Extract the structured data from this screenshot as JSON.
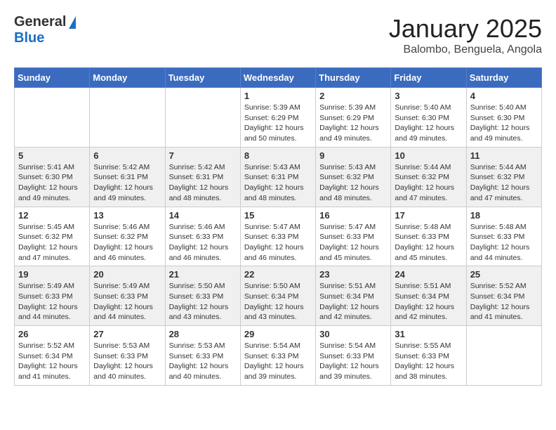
{
  "header": {
    "logo_general": "General",
    "logo_blue": "Blue",
    "month_title": "January 2025",
    "subtitle": "Balombo, Benguela, Angola"
  },
  "days_of_week": [
    "Sunday",
    "Monday",
    "Tuesday",
    "Wednesday",
    "Thursday",
    "Friday",
    "Saturday"
  ],
  "weeks": [
    [
      {
        "day": "",
        "info": ""
      },
      {
        "day": "",
        "info": ""
      },
      {
        "day": "",
        "info": ""
      },
      {
        "day": "1",
        "info": "Sunrise: 5:39 AM\nSunset: 6:29 PM\nDaylight: 12 hours\nand 50 minutes."
      },
      {
        "day": "2",
        "info": "Sunrise: 5:39 AM\nSunset: 6:29 PM\nDaylight: 12 hours\nand 49 minutes."
      },
      {
        "day": "3",
        "info": "Sunrise: 5:40 AM\nSunset: 6:30 PM\nDaylight: 12 hours\nand 49 minutes."
      },
      {
        "day": "4",
        "info": "Sunrise: 5:40 AM\nSunset: 6:30 PM\nDaylight: 12 hours\nand 49 minutes."
      }
    ],
    [
      {
        "day": "5",
        "info": "Sunrise: 5:41 AM\nSunset: 6:30 PM\nDaylight: 12 hours\nand 49 minutes."
      },
      {
        "day": "6",
        "info": "Sunrise: 5:42 AM\nSunset: 6:31 PM\nDaylight: 12 hours\nand 49 minutes."
      },
      {
        "day": "7",
        "info": "Sunrise: 5:42 AM\nSunset: 6:31 PM\nDaylight: 12 hours\nand 48 minutes."
      },
      {
        "day": "8",
        "info": "Sunrise: 5:43 AM\nSunset: 6:31 PM\nDaylight: 12 hours\nand 48 minutes."
      },
      {
        "day": "9",
        "info": "Sunrise: 5:43 AM\nSunset: 6:32 PM\nDaylight: 12 hours\nand 48 minutes."
      },
      {
        "day": "10",
        "info": "Sunrise: 5:44 AM\nSunset: 6:32 PM\nDaylight: 12 hours\nand 47 minutes."
      },
      {
        "day": "11",
        "info": "Sunrise: 5:44 AM\nSunset: 6:32 PM\nDaylight: 12 hours\nand 47 minutes."
      }
    ],
    [
      {
        "day": "12",
        "info": "Sunrise: 5:45 AM\nSunset: 6:32 PM\nDaylight: 12 hours\nand 47 minutes."
      },
      {
        "day": "13",
        "info": "Sunrise: 5:46 AM\nSunset: 6:32 PM\nDaylight: 12 hours\nand 46 minutes."
      },
      {
        "day": "14",
        "info": "Sunrise: 5:46 AM\nSunset: 6:33 PM\nDaylight: 12 hours\nand 46 minutes."
      },
      {
        "day": "15",
        "info": "Sunrise: 5:47 AM\nSunset: 6:33 PM\nDaylight: 12 hours\nand 46 minutes."
      },
      {
        "day": "16",
        "info": "Sunrise: 5:47 AM\nSunset: 6:33 PM\nDaylight: 12 hours\nand 45 minutes."
      },
      {
        "day": "17",
        "info": "Sunrise: 5:48 AM\nSunset: 6:33 PM\nDaylight: 12 hours\nand 45 minutes."
      },
      {
        "day": "18",
        "info": "Sunrise: 5:48 AM\nSunset: 6:33 PM\nDaylight: 12 hours\nand 44 minutes."
      }
    ],
    [
      {
        "day": "19",
        "info": "Sunrise: 5:49 AM\nSunset: 6:33 PM\nDaylight: 12 hours\nand 44 minutes."
      },
      {
        "day": "20",
        "info": "Sunrise: 5:49 AM\nSunset: 6:33 PM\nDaylight: 12 hours\nand 44 minutes."
      },
      {
        "day": "21",
        "info": "Sunrise: 5:50 AM\nSunset: 6:33 PM\nDaylight: 12 hours\nand 43 minutes."
      },
      {
        "day": "22",
        "info": "Sunrise: 5:50 AM\nSunset: 6:34 PM\nDaylight: 12 hours\nand 43 minutes."
      },
      {
        "day": "23",
        "info": "Sunrise: 5:51 AM\nSunset: 6:34 PM\nDaylight: 12 hours\nand 42 minutes."
      },
      {
        "day": "24",
        "info": "Sunrise: 5:51 AM\nSunset: 6:34 PM\nDaylight: 12 hours\nand 42 minutes."
      },
      {
        "day": "25",
        "info": "Sunrise: 5:52 AM\nSunset: 6:34 PM\nDaylight: 12 hours\nand 41 minutes."
      }
    ],
    [
      {
        "day": "26",
        "info": "Sunrise: 5:52 AM\nSunset: 6:34 PM\nDaylight: 12 hours\nand 41 minutes."
      },
      {
        "day": "27",
        "info": "Sunrise: 5:53 AM\nSunset: 6:33 PM\nDaylight: 12 hours\nand 40 minutes."
      },
      {
        "day": "28",
        "info": "Sunrise: 5:53 AM\nSunset: 6:33 PM\nDaylight: 12 hours\nand 40 minutes."
      },
      {
        "day": "29",
        "info": "Sunrise: 5:54 AM\nSunset: 6:33 PM\nDaylight: 12 hours\nand 39 minutes."
      },
      {
        "day": "30",
        "info": "Sunrise: 5:54 AM\nSunset: 6:33 PM\nDaylight: 12 hours\nand 39 minutes."
      },
      {
        "day": "31",
        "info": "Sunrise: 5:55 AM\nSunset: 6:33 PM\nDaylight: 12 hours\nand 38 minutes."
      },
      {
        "day": "",
        "info": ""
      }
    ]
  ]
}
